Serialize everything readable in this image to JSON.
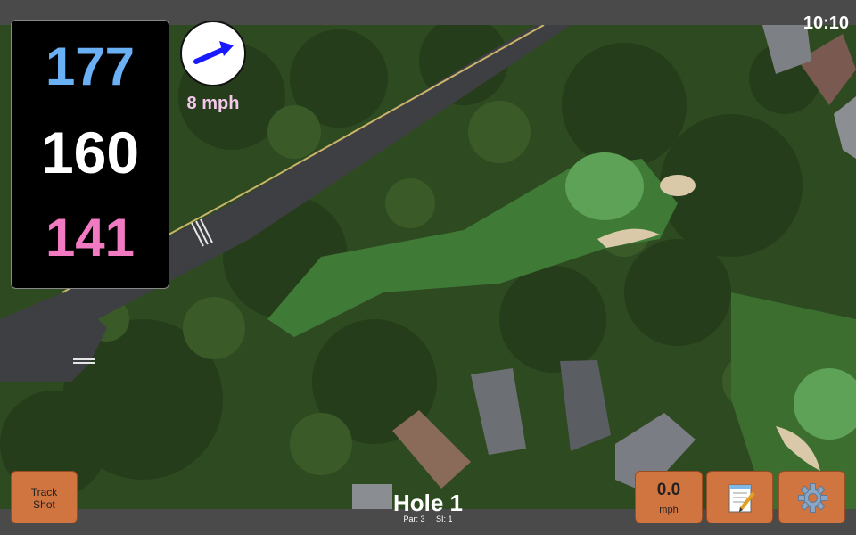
{
  "status": {
    "clock": "10:10"
  },
  "distances": {
    "back": "177",
    "middle": "160",
    "front": "141"
  },
  "wind": {
    "speed_label": "8 mph",
    "direction_icon": "wind-arrow-icon"
  },
  "buttons": {
    "track_shot_line1": "Track",
    "track_shot_line2": "Shot",
    "speed_value": "0.0",
    "speed_unit": "mph",
    "notes_icon": "notepad-icon",
    "settings_icon": "gear-icon"
  },
  "hole": {
    "title": "Hole 1",
    "par": "Par: 3",
    "si": "SI: 1"
  },
  "colors": {
    "back_distance": "#6ab0f5",
    "middle_distance": "#ffffff",
    "front_distance": "#f27ac3",
    "button": "#d07440",
    "wind_arrow": "#1a1aff"
  }
}
